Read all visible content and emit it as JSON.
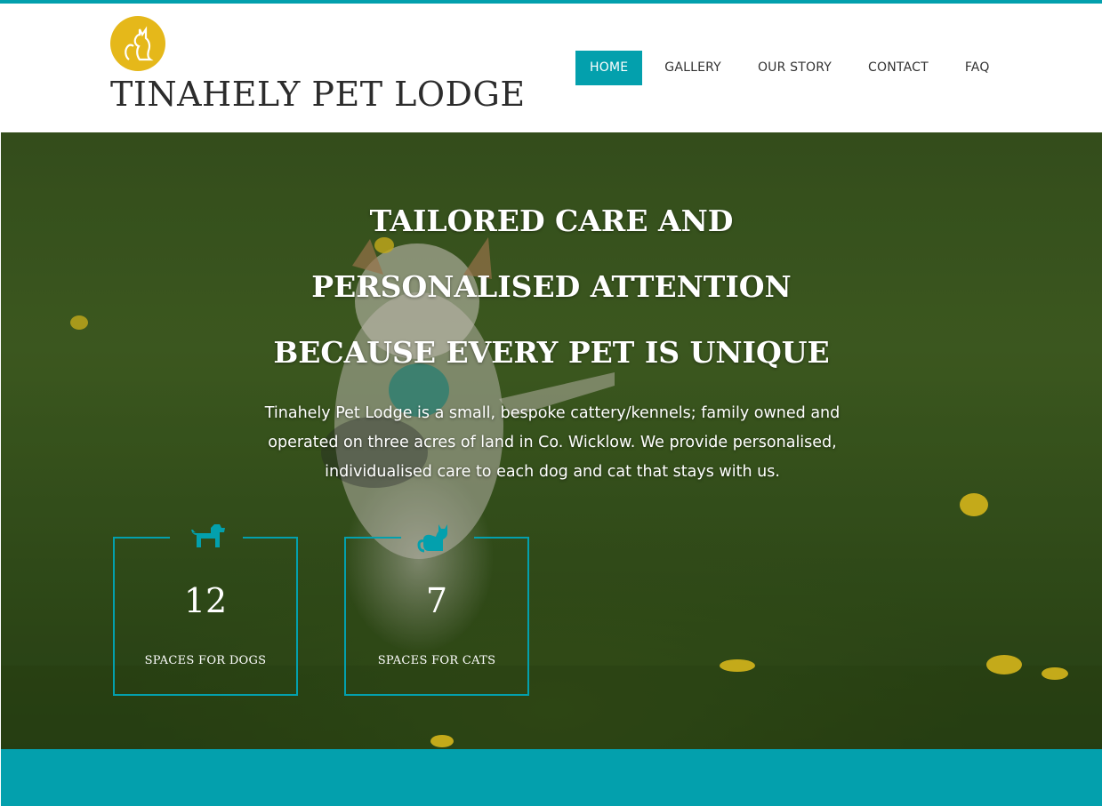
{
  "brand": {
    "site_title": "TINAHELY PET LODGE",
    "accent_color": "#03a0ad",
    "logo_color": "#e5b81a",
    "logo_icon": "cat-silhouette-icon"
  },
  "nav": {
    "items": [
      {
        "label": "HOME",
        "active": true
      },
      {
        "label": "GALLERY",
        "active": false
      },
      {
        "label": "OUR STORY",
        "active": false
      },
      {
        "label": "CONTACT",
        "active": false
      },
      {
        "label": "FAQ",
        "active": false
      }
    ]
  },
  "hero": {
    "headline_lines": [
      "TAILORED CARE AND",
      "PERSONALISED ATTENTION",
      "BECAUSE EVERY PET IS UNIQUE"
    ],
    "description": "Tinahely Pet Lodge is a small, bespoke cattery/kennels; family owned and operated on three acres of land in Co. Wicklow. We provide personalised, individualised care to each dog and cat that stays with us.",
    "background": "dog running on grass with ball"
  },
  "stats": [
    {
      "icon": "dog-icon",
      "number": "12",
      "label": "SPACES FOR DOGS"
    },
    {
      "icon": "cat-icon",
      "number": "7",
      "label": "SPACES FOR CATS"
    }
  ]
}
